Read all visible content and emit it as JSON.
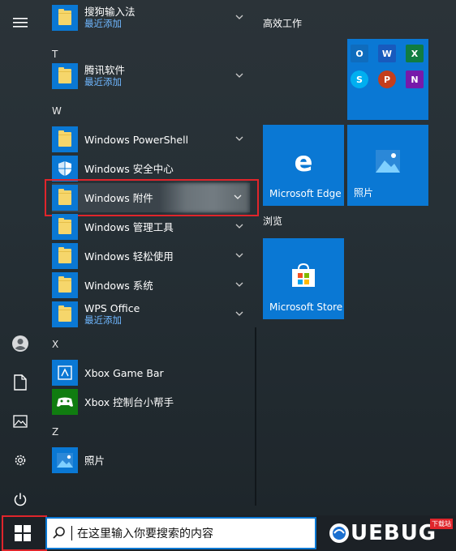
{
  "apps": {
    "sogou": {
      "name": "搜狗输入法",
      "sub": "最近添加"
    },
    "tencent": {
      "name": "腾讯软件",
      "sub": "最近添加"
    },
    "powershell": {
      "name": "Windows PowerShell"
    },
    "security": {
      "name": "Windows 安全中心"
    },
    "accessories": {
      "name": "Windows 附件"
    },
    "admin": {
      "name": "Windows 管理工具"
    },
    "ease": {
      "name": "Windows 轻松使用"
    },
    "system": {
      "name": "Windows 系统"
    },
    "wps": {
      "name": "WPS Office",
      "sub": "最近添加"
    },
    "xboxbar": {
      "name": "Xbox Game Bar"
    },
    "xboxhelper": {
      "name": "Xbox 控制台小帮手"
    },
    "photos": {
      "name": "照片"
    }
  },
  "headers": {
    "t": "T",
    "w": "W",
    "x": "X",
    "z": "Z"
  },
  "tiles": {
    "group1": "高效工作",
    "group2": "浏览",
    "edge": "Microsoft Edge",
    "photos": "照片",
    "store": "Microsoft Store",
    "office_apps": [
      "O",
      "W",
      "X",
      "S",
      "P",
      "N"
    ]
  },
  "taskbar": {
    "search_placeholder": "在这里输入你要搜索的内容",
    "brand": "UEBUG",
    "brand_small": "下载站"
  },
  "colors": {
    "accent": "#0a78d4",
    "highlight_box": "#e0252b",
    "sub_text": "#6fb7ff",
    "folder": "#f6d66b"
  }
}
